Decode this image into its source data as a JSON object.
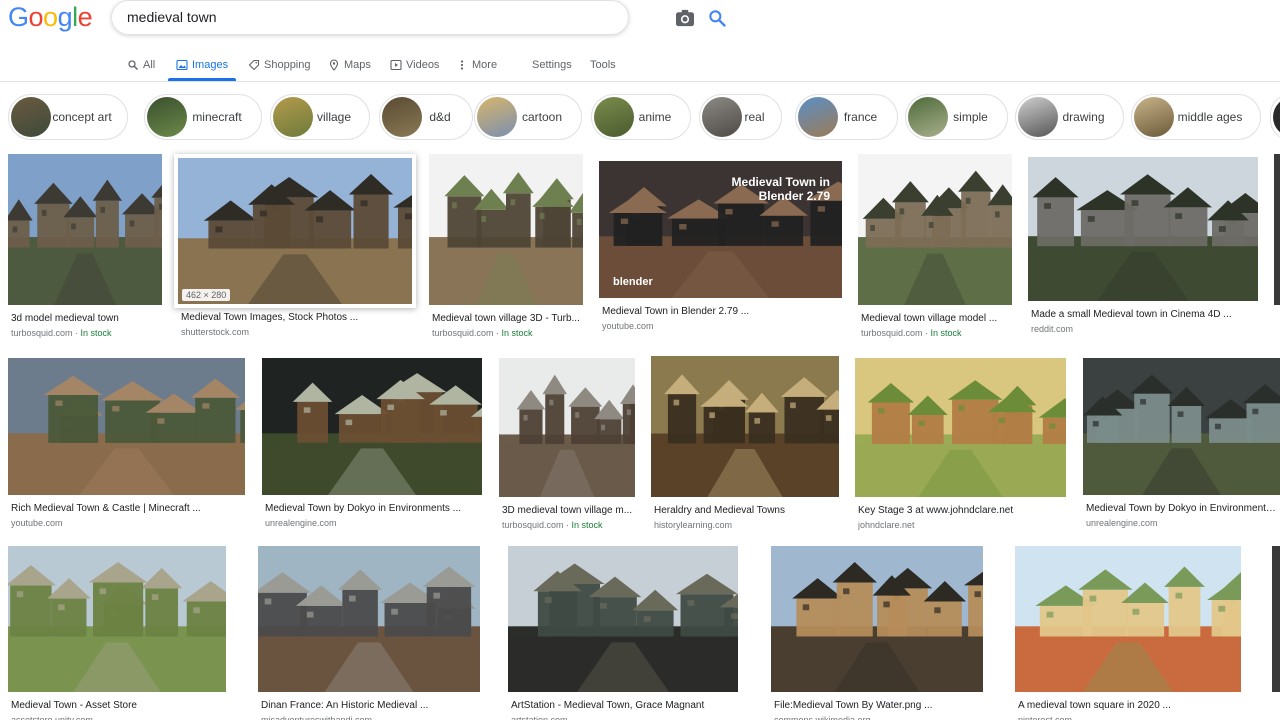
{
  "logo": {
    "text": "Google",
    "colors": [
      "#4285F4",
      "#EA4335",
      "#FBBC05",
      "#4285F4",
      "#34A853",
      "#EA4335"
    ]
  },
  "search": {
    "query": "medieval town"
  },
  "nav": {
    "all": "All",
    "images": "Images",
    "shopping": "Shopping",
    "maps": "Maps",
    "videos": "Videos",
    "more": "More",
    "settings": "Settings",
    "tools": "Tools"
  },
  "chips": [
    "concept art",
    "minecraft",
    "village",
    "d&d",
    "cartoon",
    "anime",
    "real",
    "france",
    "simple",
    "drawing",
    "middle ages"
  ],
  "results": [
    {
      "title": "3d model medieval town",
      "source": "turbosquid.com",
      "stock": "In stock"
    },
    {
      "title": "Medieval Town Images, Stock Photos ...",
      "source": "shutterstock.com",
      "stock": "",
      "dims": "462 × 280"
    },
    {
      "title": "Medieval town village 3D - Turb...",
      "source": "turbosquid.com",
      "stock": "In stock"
    },
    {
      "title": "Medieval Town in Blender 2.79 ...",
      "source": "youtube.com",
      "stock": "",
      "overlay": "Medieval Town in Blender 2.79",
      "brand": "blender"
    },
    {
      "title": "Medieval town village model ...",
      "source": "turbosquid.com",
      "stock": "In stock"
    },
    {
      "title": "Made a small Medieval town in Cinema 4D ...",
      "source": "reddit.com",
      "stock": ""
    },
    {
      "title": "Rich Medieval Town & Castle | Minecraft ...",
      "source": "youtube.com",
      "stock": ""
    },
    {
      "title": "Medieval Town by Dokyo in Environments ...",
      "source": "unrealengine.com",
      "stock": ""
    },
    {
      "title": "3D medieval town village m...",
      "source": "turbosquid.com",
      "stock": "In stock"
    },
    {
      "title": "Heraldry and Medieval Towns",
      "source": "historylearning.com",
      "stock": ""
    },
    {
      "title": "Key Stage 3 at www.johndclare.net",
      "source": "johndclare.net",
      "stock": ""
    },
    {
      "title": "Medieval Town by Dokyo in Environments ...",
      "source": "unrealengine.com",
      "stock": ""
    },
    {
      "title": "Medieval Town - Asset Store",
      "source": "assetstore.unity.com",
      "stock": ""
    },
    {
      "title": "Dinan France: An Historic Medieval ...",
      "source": "misadventureswithandi.com",
      "stock": ""
    },
    {
      "title": "ArtStation - Medieval Town, Grace Magnant",
      "source": "artstation.com",
      "stock": ""
    },
    {
      "title": "File:Medieval Town By Water.png ...",
      "source": "commons.wikimedia.org",
      "stock": ""
    },
    {
      "title": "A medieval town square in 2020 ...",
      "source": "pinterest.com",
      "stock": ""
    }
  ],
  "colors": {
    "accent": "#1a73e8",
    "stock": "#188038",
    "source": "#70757a"
  }
}
